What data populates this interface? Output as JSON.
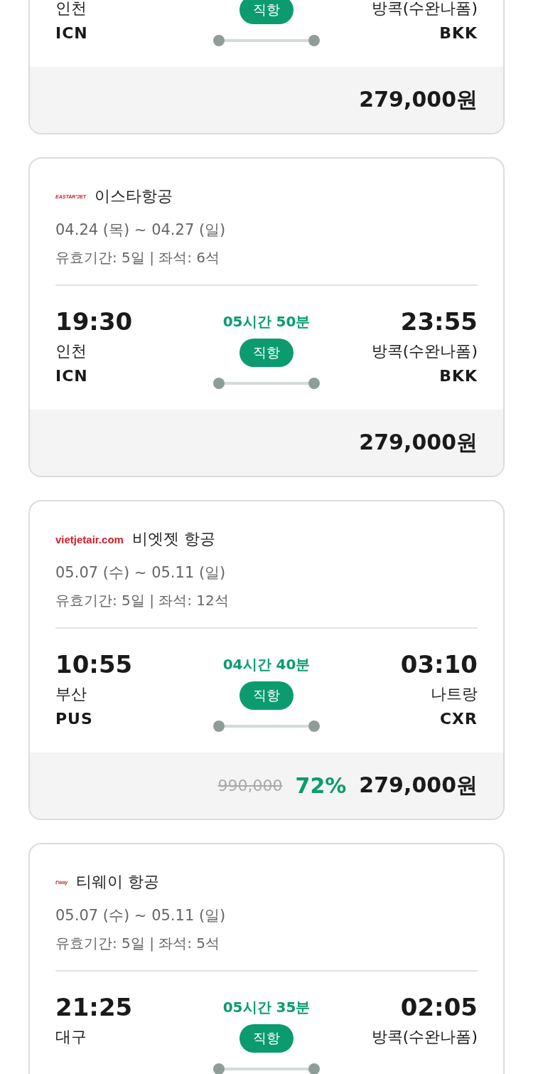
{
  "flights": [
    {
      "from_city": "인천",
      "from_code": "ICN",
      "to_city": "방콕(수완나폼)",
      "to_code": "BKK",
      "badge": "직항",
      "price": "279,000원"
    },
    {
      "logo": "EASTAR⁺JET",
      "airline": "이스타항공",
      "dates": "04.24 (목) ~ 04.27 (일)",
      "validity": "유효기간: 5일 | 좌석: 6석",
      "depart_time": "19:30",
      "duration": "05시간 50분",
      "arrive_time": "23:55",
      "from_city": "인천",
      "from_code": "ICN",
      "to_city": "방콕(수완나폼)",
      "to_code": "BKK",
      "badge": "직항",
      "price": "279,000원"
    },
    {
      "logo": "vietjetair.com",
      "airline": "비엣젯 항공",
      "dates": "05.07 (수) ~ 05.11 (일)",
      "validity": "유효기간: 5일 | 좌석: 12석",
      "depart_time": "10:55",
      "duration": "04시간 40분",
      "arrive_time": "03:10",
      "from_city": "부산",
      "from_code": "PUS",
      "to_city": "나트랑",
      "to_code": "CXR",
      "badge": "직항",
      "original_price": "990,000",
      "discount": "72%",
      "price": "279,000원"
    },
    {
      "logo": "t'way",
      "airline": "티웨이 항공",
      "dates": "05.07 (수) ~ 05.11 (일)",
      "validity": "유효기간: 5일 | 좌석: 5석",
      "depart_time": "21:25",
      "duration": "05시간 35분",
      "arrive_time": "02:05",
      "from_city": "대구",
      "to_city": "방콕(수완나폼)",
      "badge": "직항"
    }
  ]
}
